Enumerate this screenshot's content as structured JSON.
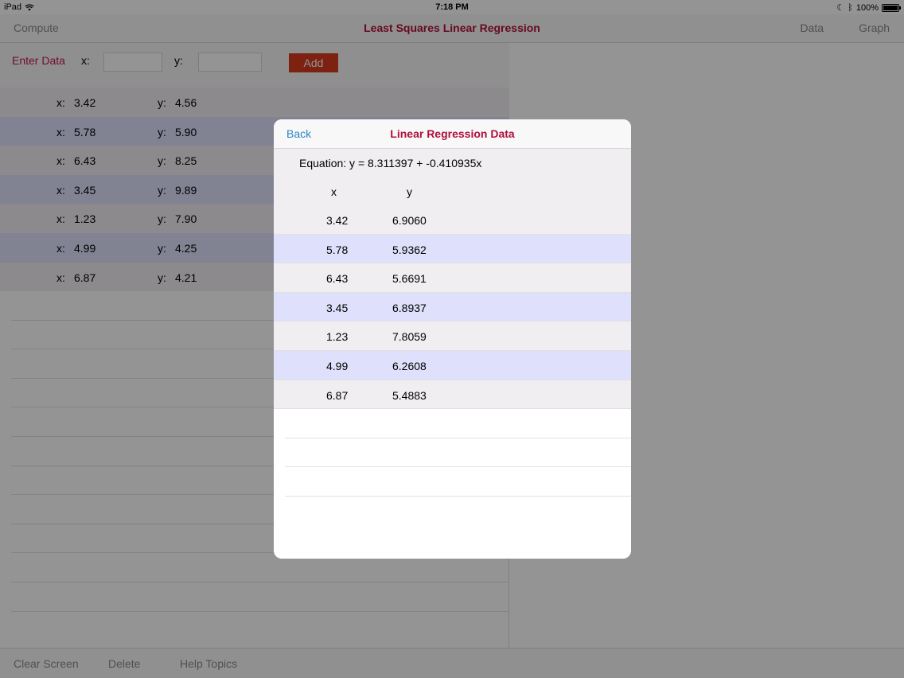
{
  "status_bar": {
    "device": "iPad",
    "time": "7:18 PM",
    "battery": "100%",
    "battery_level": 1.0
  },
  "nav": {
    "left_button": "Compute",
    "title": "Least Squares Linear Regression",
    "right_buttons": [
      "Data",
      "Graph"
    ]
  },
  "entry": {
    "label": "Enter Data",
    "x_label": "x:",
    "y_label": "y:",
    "x_value": "",
    "y_value": "",
    "add_label": "Add"
  },
  "data_rows": [
    {
      "x_label": "x:",
      "x": "3.42",
      "y_label": "y:",
      "y": "4.56"
    },
    {
      "x_label": "x:",
      "x": "5.78",
      "y_label": "y:",
      "y": "5.90"
    },
    {
      "x_label": "x:",
      "x": "6.43",
      "y_label": "y:",
      "y": "8.25"
    },
    {
      "x_label": "x:",
      "x": "3.45",
      "y_label": "y:",
      "y": "9.89"
    },
    {
      "x_label": "x:",
      "x": "1.23",
      "y_label": "y:",
      "y": "7.90"
    },
    {
      "x_label": "x:",
      "x": "4.99",
      "y_label": "y:",
      "y": "4.25"
    },
    {
      "x_label": "x:",
      "x": "6.87",
      "y_label": "y:",
      "y": "4.21"
    }
  ],
  "toolbar": {
    "clear_label": "Clear Screen",
    "delete_label": "Delete",
    "help_label": "Help Topics"
  },
  "modal": {
    "back_label": "Back",
    "title": "Linear Regression Data",
    "equation": "Equation: y = 8.311397 + -0.410935x",
    "col_x": "x",
    "col_y": "y",
    "rows": [
      {
        "x": "3.42",
        "y": "6.9060"
      },
      {
        "x": "5.78",
        "y": "5.9362"
      },
      {
        "x": "6.43",
        "y": "5.6691"
      },
      {
        "x": "3.45",
        "y": "6.8937"
      },
      {
        "x": "1.23",
        "y": "7.8059"
      },
      {
        "x": "4.99",
        "y": "6.2608"
      },
      {
        "x": "6.87",
        "y": "5.4883"
      }
    ]
  },
  "colors": {
    "accent": "#b0103c",
    "link": "#2a86c6",
    "add_button": "#d83a1c",
    "row_odd": "#f1eef1",
    "row_even": "#dfe0fb"
  }
}
